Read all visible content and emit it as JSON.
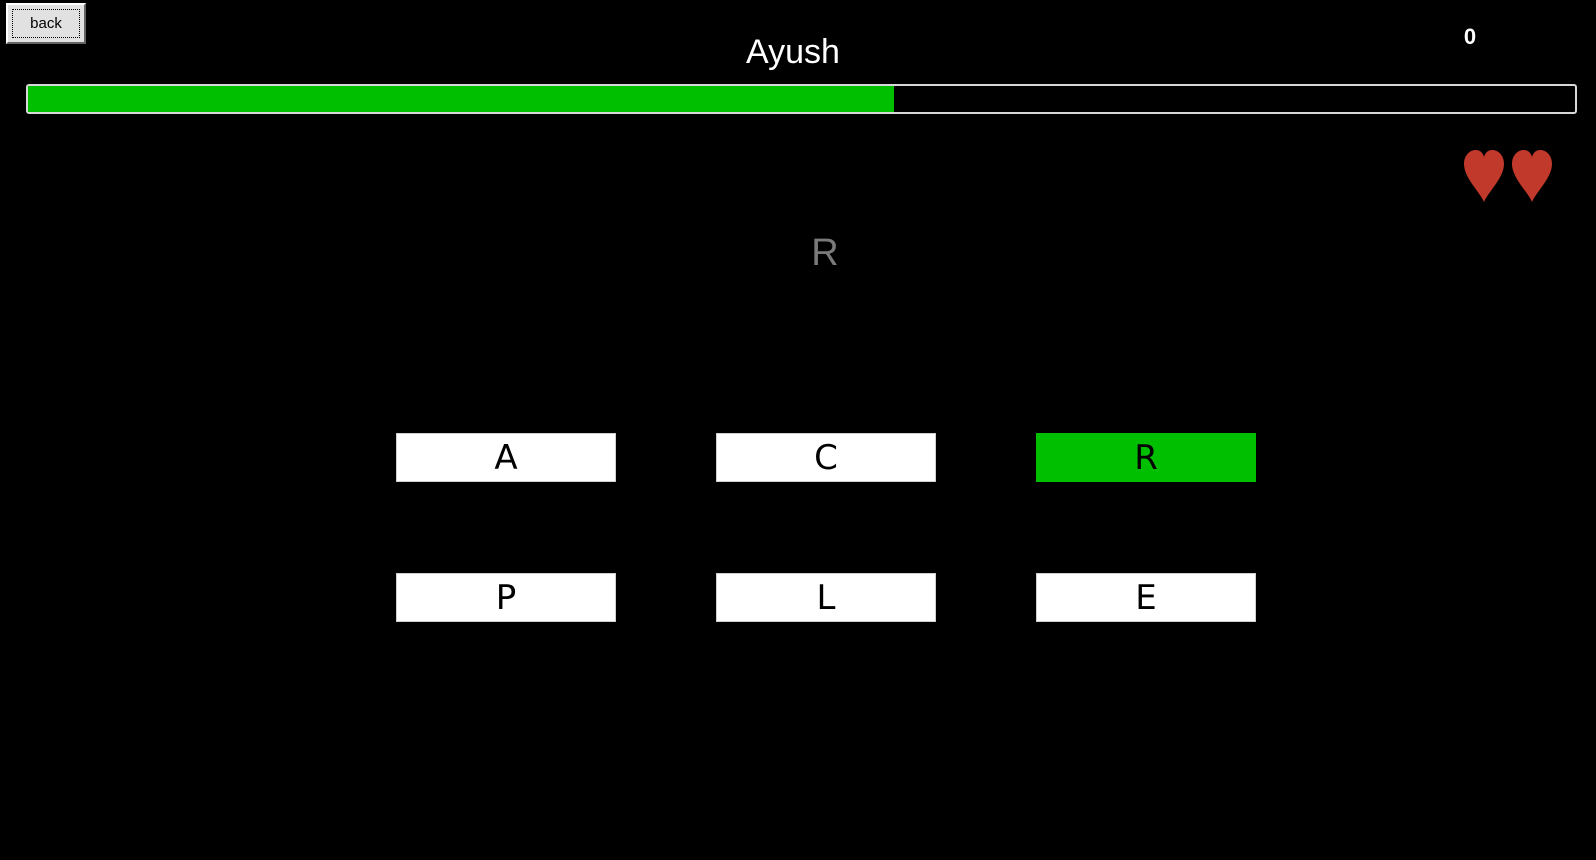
{
  "back_button": {
    "label": "back"
  },
  "player_name": "Ayush",
  "score": "0",
  "progress": {
    "fraction": 0.56,
    "fill_color": "#00bf00"
  },
  "lives": {
    "count": 2,
    "icon": "heart-icon",
    "color": "#c0392b"
  },
  "target_letter": "R",
  "choices": [
    {
      "label": "A",
      "selected": false
    },
    {
      "label": "C",
      "selected": false
    },
    {
      "label": "R",
      "selected": true
    },
    {
      "label": "P",
      "selected": false
    },
    {
      "label": "L",
      "selected": false
    },
    {
      "label": "E",
      "selected": false
    }
  ],
  "colors": {
    "background": "#000000",
    "selected": "#00bf00",
    "target_letter": "#7a7a7a"
  }
}
